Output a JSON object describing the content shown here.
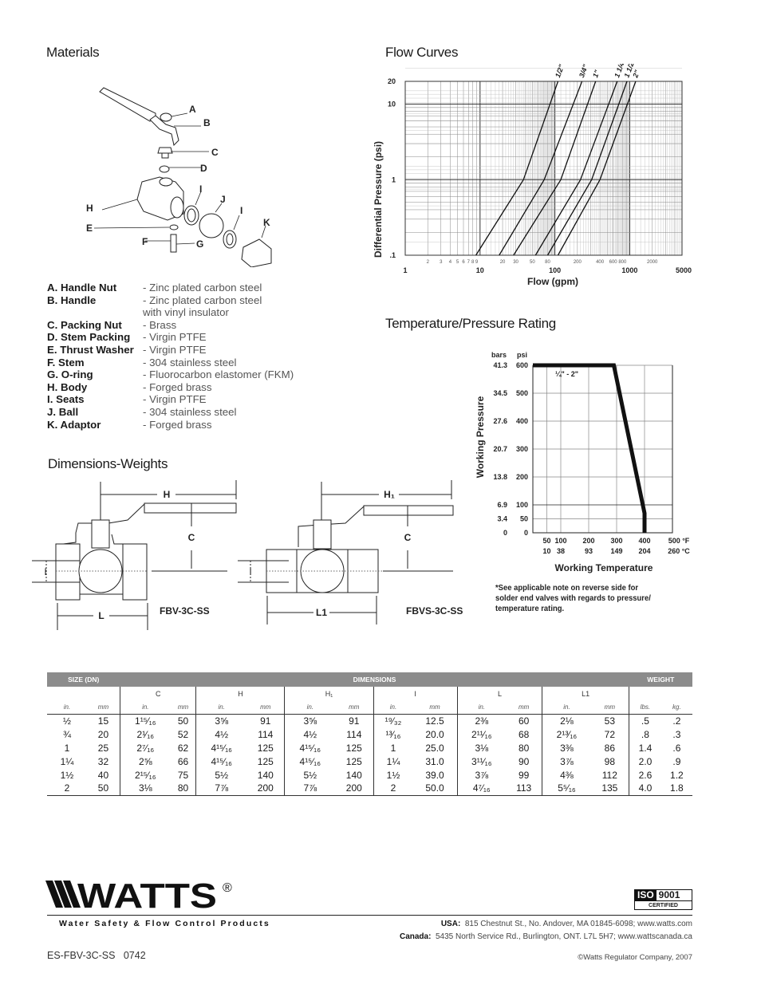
{
  "headings": {
    "materials": "Materials",
    "flow_curves": "Flow Curves",
    "temp_pressure": "Temperature/Pressure Rating",
    "dimensions_weights": "Dimensions-Weights"
  },
  "exploded_view": {
    "callouts": [
      "A",
      "B",
      "C",
      "D",
      "H",
      "E",
      "F",
      "G",
      "I",
      "J",
      "I",
      "K"
    ]
  },
  "materials": [
    {
      "part": "A. Handle Nut",
      "material": "- Zinc plated carbon steel"
    },
    {
      "part": "B. Handle",
      "material": "- Zinc plated carbon steel\n  with vinyl insulator"
    },
    {
      "part": "C. Packing Nut",
      "material": "- Brass"
    },
    {
      "part": "D. Stem Packing",
      "material": "- Virgin PTFE"
    },
    {
      "part": "E. Thrust Washer",
      "material": "- Virgin PTFE"
    },
    {
      "part": "F. Stem",
      "material": "- 304 stainless steel"
    },
    {
      "part": "G. O-ring",
      "material": "- Fluorocarbon elastomer (FKM)"
    },
    {
      "part": "H. Body",
      "material": "- Forged brass"
    },
    {
      "part": "I.  Seats",
      "material": "- Virgin PTFE"
    },
    {
      "part": "J. Ball",
      "material": "- 304 stainless steel"
    },
    {
      "part": "K. Adaptor",
      "material": "- Forged brass"
    }
  ],
  "chart_data": [
    {
      "type": "line",
      "title": "Flow Curves",
      "xlabel": "Flow (gpm)",
      "ylabel": "Differential Pressure (psi)",
      "xscale": "log",
      "yscale": "log",
      "xlim": [
        1,
        5000
      ],
      "ylim": [
        0.1,
        20
      ],
      "x_major_ticks": [
        "1",
        "10",
        "100",
        "1000",
        "5000"
      ],
      "x_minor_ticks": [
        "2",
        "3",
        "4",
        "5",
        "6",
        "7",
        "8",
        "9",
        "20",
        "30",
        "50",
        "80",
        "200",
        "400",
        "600",
        "800",
        "2000"
      ],
      "y_ticks": [
        ".1",
        "1",
        "10",
        "20"
      ],
      "grid": true,
      "series": [
        {
          "name": "1/2\"",
          "points": [
            [
              8.8,
              0.1
            ],
            [
              38,
              1
            ],
            [
              110,
              20
            ]
          ]
        },
        {
          "name": "3/4\"",
          "points": [
            [
              18,
              0.1
            ],
            [
              72,
              1
            ],
            [
              230,
              20
            ]
          ]
        },
        {
          "name": "1\"",
          "points": [
            [
              28,
              0.1
            ],
            [
              120,
              1
            ],
            [
              350,
              20
            ]
          ]
        },
        {
          "name": "1 1/4\"",
          "points": [
            [
              55,
              0.1
            ],
            [
              220,
              1
            ],
            [
              680,
              20
            ]
          ]
        },
        {
          "name": "1 1/2\"",
          "points": [
            [
              80,
              0.1
            ],
            [
              310,
              1
            ],
            [
              920,
              20
            ]
          ]
        },
        {
          "name": "2\"",
          "points": [
            [
              110,
              0.1
            ],
            [
              400,
              1
            ],
            [
              1200,
              20
            ]
          ]
        }
      ]
    },
    {
      "type": "line",
      "title": "Temperature/Pressure Rating",
      "xlabel": "Working Temperature",
      "ylabel": "Working Pressure",
      "xlim": [
        0,
        500
      ],
      "ylim": [
        0,
        600
      ],
      "x_ticks_f": [
        "50",
        "100",
        "200",
        "300",
        "400",
        "500 °F"
      ],
      "x_ticks_c": [
        "10",
        "38",
        "93",
        "149",
        "204",
        "260 °C"
      ],
      "x_tick_values": [
        50,
        100,
        200,
        300,
        400,
        500
      ],
      "y_ticks_bars": [
        "0",
        "3.4",
        "6.9",
        "13.8",
        "20.7",
        "27.6",
        "34.5",
        "41.3"
      ],
      "y_ticks_psi": [
        "0",
        "50",
        "100",
        "200",
        "300",
        "400",
        "500",
        "600"
      ],
      "y_tick_values": [
        0,
        50,
        100,
        200,
        300,
        400,
        500,
        600
      ],
      "y_unit_labels": {
        "bars": "bars",
        "psi": "psi"
      },
      "grid": true,
      "series": [
        {
          "name": "1/4\" - 2\"",
          "points": [
            [
              0,
              600
            ],
            [
              290,
              600
            ],
            [
              400,
              70
            ],
            [
              400,
              0
            ]
          ]
        }
      ],
      "annotation": "¼\" - 2\""
    }
  ],
  "temp_note": "*See applicable note on reverse side for\n  solder end valves with regards to pressure/\n  temperature rating.",
  "diagrams": {
    "fbv": {
      "model": "FBV-3C-SS",
      "labels": {
        "h": "H",
        "c": "C",
        "i": "I",
        "l": "L"
      }
    },
    "fbvs": {
      "model": "FBVS-3C-SS",
      "labels": {
        "h": "H₁",
        "c": "C",
        "i": "I",
        "l": "L1"
      }
    }
  },
  "table": {
    "bands": {
      "size": "SIZE (DN)",
      "dimensions": "DIMENSIONS",
      "weight": "WEIGHT"
    },
    "groups": [
      "C",
      "H",
      "H₁",
      "I",
      "L",
      "L1"
    ],
    "units": [
      "in.",
      "mm",
      "in.",
      "mm",
      "in.",
      "mm",
      "in.",
      "mm",
      "in.",
      "mm",
      "in.",
      "mm",
      "in.",
      "mm",
      "lbs.",
      "kg."
    ],
    "rows": [
      [
        "½",
        "15",
        "1¹⁵⁄₁₆",
        "50",
        "3⅝",
        "91",
        "3⅝",
        "91",
        "¹⁹⁄₃₂",
        "12.5",
        "2⅜",
        "60",
        "2⅛",
        "53",
        ".5",
        ".2"
      ],
      [
        "¾",
        "20",
        "2¹⁄₁₆",
        "52",
        "4½",
        "114",
        "4½",
        "114",
        "¹³⁄₁₆",
        "20.0",
        "2¹¹⁄₁₆",
        "68",
        "2¹³⁄₁₆",
        "72",
        ".8",
        ".3"
      ],
      [
        "1",
        "25",
        "2⁷⁄₁₆",
        "62",
        "4¹⁵⁄₁₆",
        "125",
        "4¹⁵⁄₁₆",
        "125",
        "1",
        "25.0",
        "3⅛",
        "80",
        "3⅜",
        "86",
        "1.4",
        ".6"
      ],
      [
        "1¼",
        "32",
        "2⅝",
        "66",
        "4¹⁵⁄₁₆",
        "125",
        "4¹⁵⁄₁₆",
        "125",
        "1¼",
        "31.0",
        "3¹¹⁄₁₆",
        "90",
        "3⅞",
        "98",
        "2.0",
        ".9"
      ],
      [
        "1½",
        "40",
        "2¹⁵⁄₁₆",
        "75",
        "5½",
        "140",
        "5½",
        "140",
        "1½",
        "39.0",
        "3⅞",
        "99",
        "4⅜",
        "112",
        "2.6",
        "1.2"
      ],
      [
        "2",
        "50",
        "3⅛",
        "80",
        "7⅞",
        "200",
        "7⅞",
        "200",
        "2",
        "50.0",
        "4⁷⁄₁₆",
        "113",
        "5⁵⁄₁₆",
        "135",
        "4.0",
        "1.8"
      ]
    ]
  },
  "footer": {
    "brand": "WATTS",
    "registered": "®",
    "tagline": "Water Safety & Flow Control Products",
    "iso": {
      "label": "ISO",
      "number": "9001",
      "certified": "CERTIFIED"
    },
    "usa_label": "USA:",
    "usa_address": "815 Chestnut St., No. Andover, MA 01845-6098; www.watts.com",
    "canada_label": "Canada:",
    "canada_address": "5435 North Service Rd., Burlington, ONT. L7L 5H7; www.wattscanada.ca",
    "doc_id": "ES-FBV-3C-SS   0742",
    "copyright": "©Watts Regulator Company, 2007"
  }
}
